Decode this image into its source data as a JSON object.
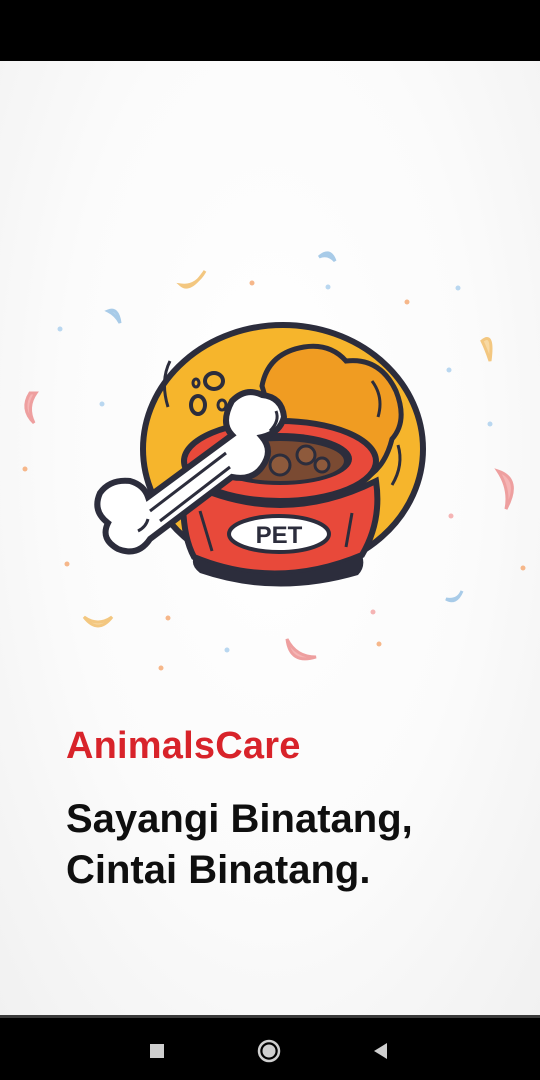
{
  "app": {
    "brand_name": "AnimalsCare",
    "tagline_line1": "Sayangi Binatang,",
    "tagline_line2": "Cintai Binatang."
  },
  "illustration": {
    "bowl_label": "PET",
    "icons": [
      "pet-food-bowl-icon",
      "bone-icon",
      "cookie-icon"
    ]
  },
  "colors": {
    "brand_red": "#d8232a",
    "bowl_red": "#e8493a",
    "cookie_yellow": "#f6b52c",
    "outline": "#2c2d3c",
    "bone_white": "#ffffff"
  },
  "navigation": {
    "buttons": [
      "recents-button",
      "home-button",
      "back-button"
    ]
  }
}
